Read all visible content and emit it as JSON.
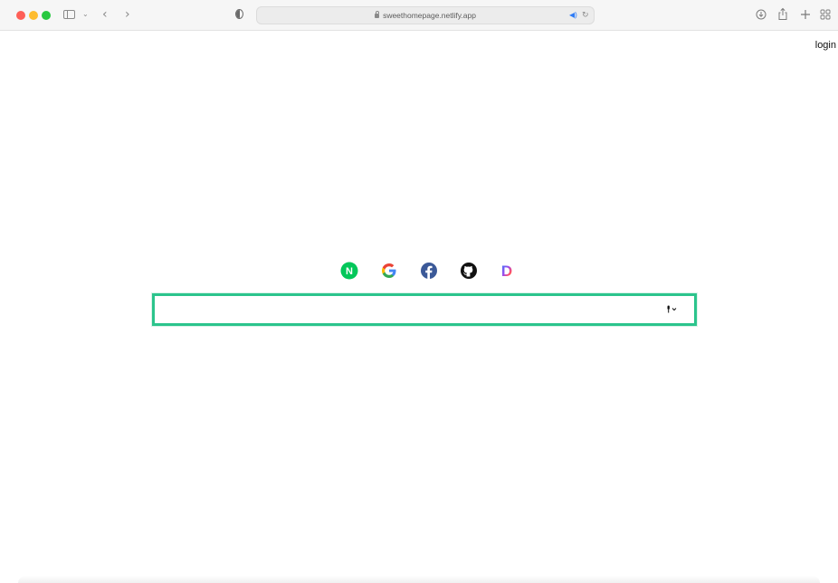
{
  "browser": {
    "url": "sweethomepage.netlify.app",
    "colors": {
      "close": "#fe5f57",
      "minimize": "#febc2e",
      "zoom": "#28c840"
    },
    "icons": {
      "sidebar": "sidebar-icon",
      "back": "chevron-left-icon",
      "forward": "chevron-right-icon",
      "privacy": "shield-icon",
      "download": "download-icon",
      "share": "share-icon",
      "new_tab": "plus-icon",
      "tab_overview": "grid-icon"
    }
  },
  "page": {
    "login_label": "login",
    "shortcuts": [
      {
        "name": "naver",
        "letter": "N",
        "color": "#03c75a"
      },
      {
        "name": "google",
        "letter": "G",
        "color": "#4285f4"
      },
      {
        "name": "facebook",
        "letter": "f",
        "color": "#3b5998"
      },
      {
        "name": "github",
        "letter": "",
        "color": "#111111"
      },
      {
        "name": "daum",
        "letter": "D",
        "color": "#ff5a4e"
      }
    ],
    "search": {
      "value": "",
      "placeholder": "",
      "border_color": "#2bc48c"
    }
  }
}
